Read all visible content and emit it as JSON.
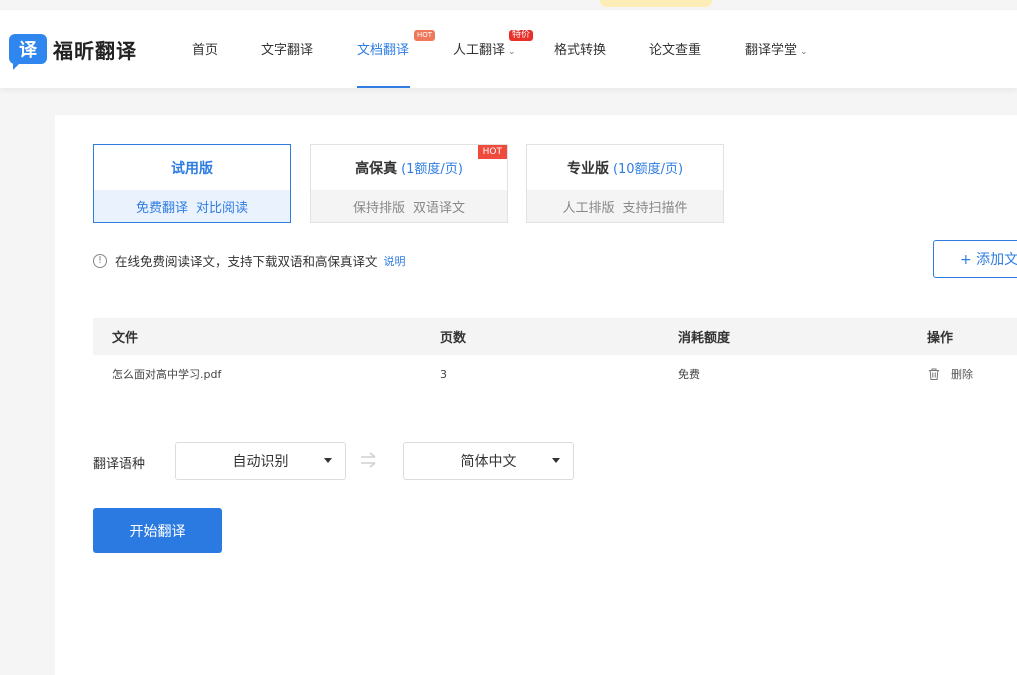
{
  "brand": {
    "badge": "译",
    "name": "福昕翻译"
  },
  "nav": {
    "items": [
      {
        "label": "首页"
      },
      {
        "label": "文字翻译"
      },
      {
        "label": "文档翻译",
        "badge": "HOT"
      },
      {
        "label": "人工翻译",
        "badge": "特价"
      },
      {
        "label": "格式转换"
      },
      {
        "label": "论文查重"
      },
      {
        "label": "翻译学堂"
      }
    ],
    "active": "文档翻译"
  },
  "plans": [
    {
      "name": "试用版",
      "quota": "",
      "features": [
        "免费翻译",
        "对比阅读"
      ],
      "selected": true
    },
    {
      "name": "高保真",
      "quota": "(1额度/页)",
      "features": [
        "保持排版",
        "双语译文"
      ],
      "tag": "HOT"
    },
    {
      "name": "专业版",
      "quota": "(10额度/页)",
      "features": [
        "人工排版",
        "支持扫描件"
      ]
    }
  ],
  "notice": {
    "text": "在线免费阅读译文，支持下载双语和高保真译文",
    "link": "说明"
  },
  "add_button": "+ 添加文",
  "table": {
    "headers": [
      "文件",
      "页数",
      "消耗额度",
      "操作"
    ],
    "rows": [
      {
        "file": "怎么面对高中学习.pdf",
        "pages": "3",
        "cost": "免费",
        "action": "删除"
      }
    ]
  },
  "language": {
    "label": "翻译语种",
    "source": "自动识别",
    "target": "简体中文"
  },
  "start_button": "开始翻译",
  "colors": {
    "accent": "#2f7de1",
    "hot": "#f04a3c"
  }
}
